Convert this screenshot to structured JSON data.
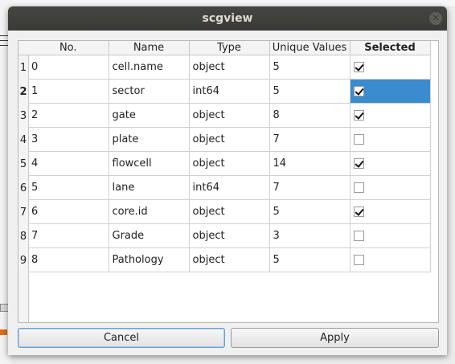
{
  "window": {
    "title": "scgview"
  },
  "table": {
    "headers": [
      "No.",
      "Name",
      "Type",
      "Unique Values",
      "Selected"
    ],
    "rows": [
      {
        "rownum": "1",
        "no": "0",
        "name": "cell.name",
        "type": "object",
        "unique": "5",
        "selected": true
      },
      {
        "rownum": "2",
        "no": "1",
        "name": "sector",
        "type": "int64",
        "unique": "5",
        "selected": true
      },
      {
        "rownum": "3",
        "no": "2",
        "name": "gate",
        "type": "object",
        "unique": "8",
        "selected": true
      },
      {
        "rownum": "4",
        "no": "3",
        "name": "plate",
        "type": "object",
        "unique": "7",
        "selected": false
      },
      {
        "rownum": "5",
        "no": "4",
        "name": "flowcell",
        "type": "object",
        "unique": "14",
        "selected": true
      },
      {
        "rownum": "6",
        "no": "5",
        "name": "lane",
        "type": "int64",
        "unique": "7",
        "selected": false
      },
      {
        "rownum": "7",
        "no": "6",
        "name": "core.id",
        "type": "object",
        "unique": "5",
        "selected": true
      },
      {
        "rownum": "8",
        "no": "7",
        "name": "Grade",
        "type": "object",
        "unique": "3",
        "selected": false
      },
      {
        "rownum": "9",
        "no": "8",
        "name": "Pathology",
        "type": "object",
        "unique": "5",
        "selected": false
      }
    ]
  },
  "buttons": {
    "cancel": "Cancel",
    "apply": "Apply"
  }
}
